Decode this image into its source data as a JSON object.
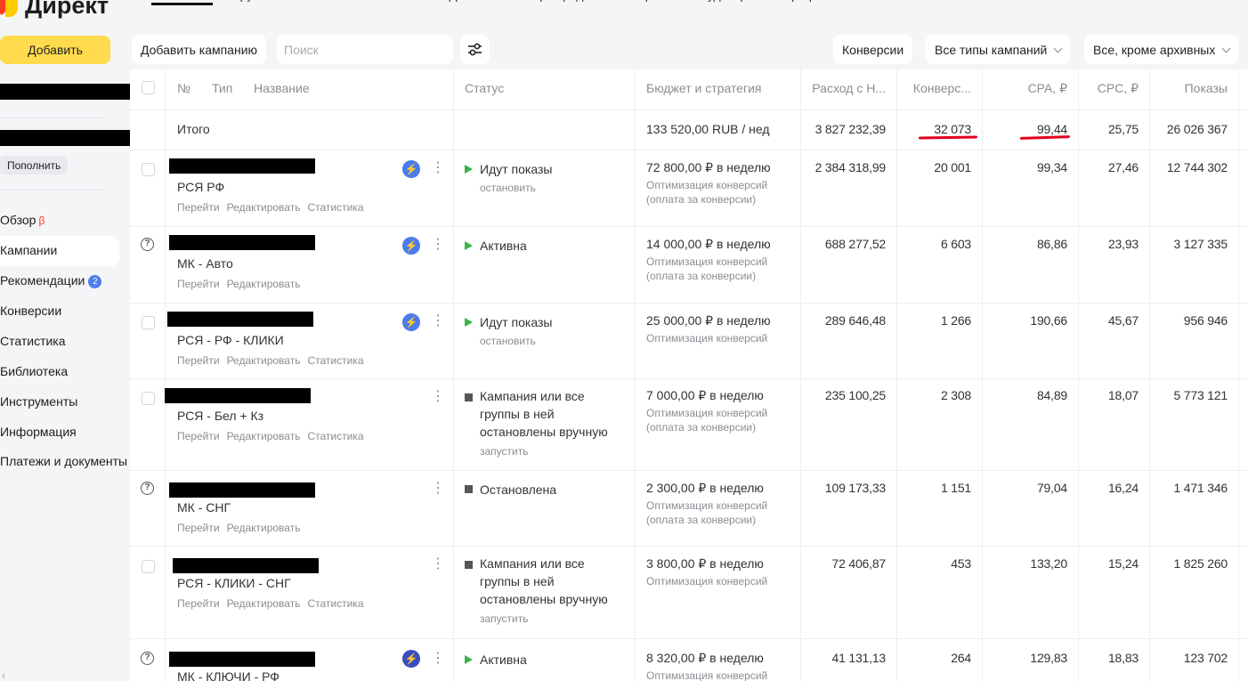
{
  "app": {
    "logo_text": "Директ"
  },
  "sidebar": {
    "add_label": "Добавить",
    "topup_label": "Пополнить",
    "nav": [
      {
        "label": "Обзор",
        "beta": "β"
      },
      {
        "label": "Кампании"
      },
      {
        "label": "Рекомендации",
        "badge": "2"
      },
      {
        "label": "Конверсии"
      },
      {
        "label": "Статистика"
      },
      {
        "label": "Библиотека"
      },
      {
        "label": "Инструменты"
      },
      {
        "label": "Информация"
      },
      {
        "label": "Платежи и документы"
      }
    ]
  },
  "tabs": [
    "Кампании",
    "Группы",
    "Объявления",
    "Ставки и фразы",
    "Фильтры фидов",
    "Ретаргетинг и аудитории",
    "Профили пользователей"
  ],
  "toolbar": {
    "add_campaign": "Добавить кампанию",
    "search_placeholder": "Поиск",
    "conversions": "Конверсии",
    "all_types": "Все типы кампаний",
    "archive_filter": "Все, кроме архивных"
  },
  "table": {
    "headers": {
      "num": "№",
      "type": "Тип",
      "name": "Название",
      "status": "Статус",
      "budget": "Бюджет и стратегия",
      "cost": "Расход с Н...",
      "conv": "Конверс...",
      "cpa": "CPA, ₽",
      "cpc": "CPC, ₽",
      "shows": "Показы"
    },
    "total": {
      "label": "Итого",
      "budget": "133 520,00 RUB / нед",
      "cost": "3 827 232,39",
      "conv": "32 073",
      "cpa": "99,44",
      "cpc": "25,75",
      "shows": "26 026 367"
    },
    "links": {
      "go": "Перейти",
      "edit": "Редактировать",
      "stats": "Статистика"
    },
    "rows": [
      {
        "name": "РСЯ РФ",
        "status": "Идут показы",
        "action": "остановить",
        "budget": "72 800,00 ₽ в неделю",
        "strategy1": "Оптимизация конверсий",
        "strategy2": "(оплата за конверсии)",
        "cost": "2 384 318,99",
        "conv": "20 001",
        "cpa": "99,34",
        "cpc": "27,46",
        "shows": "12 744 302"
      },
      {
        "name": "МК - Авто",
        "status": "Активна",
        "action": "",
        "budget": "14 000,00 ₽ в неделю",
        "strategy1": "Оптимизация конверсий",
        "strategy2": "(оплата за конверсии)",
        "cost": "688 277,52",
        "conv": "6 603",
        "cpa": "86,86",
        "cpc": "23,93",
        "shows": "3 127 335"
      },
      {
        "name": "РСЯ - РФ - КЛИКИ",
        "status": "Идут показы",
        "action": "остановить",
        "budget": "25 000,00 ₽ в неделю",
        "strategy1": "Оптимизация конверсий",
        "strategy2": "",
        "cost": "289 646,48",
        "conv": "1 266",
        "cpa": "190,66",
        "cpc": "45,67",
        "shows": "956 946"
      },
      {
        "name": "РСЯ - Бел + Кз",
        "status1": "Кампания или все",
        "status2": "группы в ней",
        "status3": "остановлены вручную",
        "action": "запустить",
        "budget": "7 000,00 ₽ в неделю",
        "strategy1": "Оптимизация конверсий",
        "strategy2": "(оплата за конверсии)",
        "cost": "235 100,25",
        "conv": "2 308",
        "cpa": "84,89",
        "cpc": "18,07",
        "shows": "5 773 121"
      },
      {
        "name": "МК - СНГ",
        "status": "Остановлена",
        "action": "",
        "budget": "2 300,00 ₽ в неделю",
        "strategy1": "Оптимизация конверсий",
        "strategy2": "(оплата за конверсии)",
        "cost": "109 173,33",
        "conv": "1 151",
        "cpa": "79,04",
        "cpc": "16,24",
        "shows": "1 471 346"
      },
      {
        "name": "РСЯ - КЛИКИ - СНГ",
        "status1": "Кампания или все",
        "status2": "группы в ней",
        "status3": "остановлены вручную",
        "action": "запустить",
        "budget": "3 800,00 ₽ в неделю",
        "strategy1": "Оптимизация конверсий",
        "strategy2": "",
        "cost": "72 406,87",
        "conv": "453",
        "cpa": "133,20",
        "cpc": "15,24",
        "shows": "1 825 260"
      },
      {
        "name": "МК - КЛЮЧИ - РФ",
        "status": "Активна",
        "action": "",
        "budget": "8 320,00 ₽ в неделю",
        "strategy1": "Оптимизация конверсий",
        "strategy2": "",
        "cost": "41 131,13",
        "conv": "264",
        "cpa": "129,83",
        "cpc": "18,83",
        "shows": "123 702"
      }
    ]
  },
  "colors": {
    "accent_yellow": "#ffdb4d",
    "active_green": "#3cb34a",
    "annotation_red": "#e3001b"
  }
}
